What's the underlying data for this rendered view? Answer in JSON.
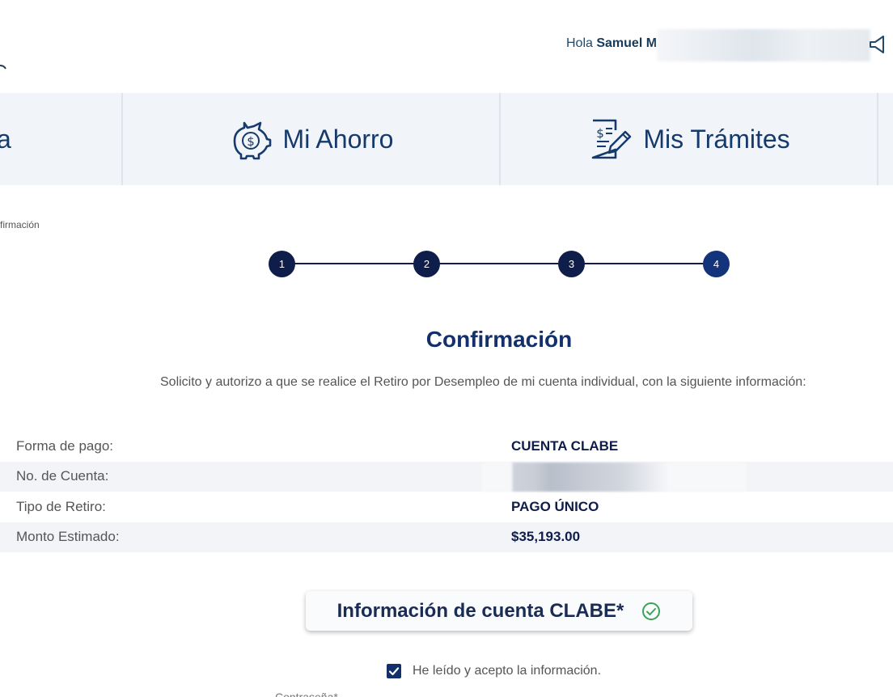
{
  "header": {
    "greeting_prefix": "Hola",
    "user_name": "Samuel M"
  },
  "nav": {
    "partial_left_label": "a",
    "items": [
      {
        "label": "Mi Ahorro",
        "icon": "piggy-bank-dollar-icon"
      },
      {
        "label": "Mis Trámites",
        "icon": "document-edit-icon"
      }
    ]
  },
  "breadcrumb": {
    "text": "firmación"
  },
  "stepper": {
    "steps": [
      "1",
      "2",
      "3",
      "4"
    ],
    "active_step": 4
  },
  "confirmation": {
    "title": "Confirmación",
    "description": "Solicito y autorizo a que se realice el Retiro por Desempleo de mi cuenta individual, con la siguiente información:",
    "rows": [
      {
        "label": "Forma de pago:",
        "value": "CUENTA CLABE"
      },
      {
        "label": "No. de Cuenta:",
        "value": ""
      },
      {
        "label": "Tipo de Retiro:",
        "value": "PAGO ÚNICO"
      },
      {
        "label": "Monto Estimado:",
        "value": "$35,193.00"
      }
    ]
  },
  "clabe_section": {
    "label": "Información de cuenta CLABE*"
  },
  "acceptance": {
    "label": "He leído y acepto la información.",
    "checked": true
  },
  "cutoff_text": "Contraseña*",
  "colors": {
    "navy": "#0e1d4a",
    "nav_bg": "#f1f4f8",
    "check_green": "#3aa35a"
  }
}
